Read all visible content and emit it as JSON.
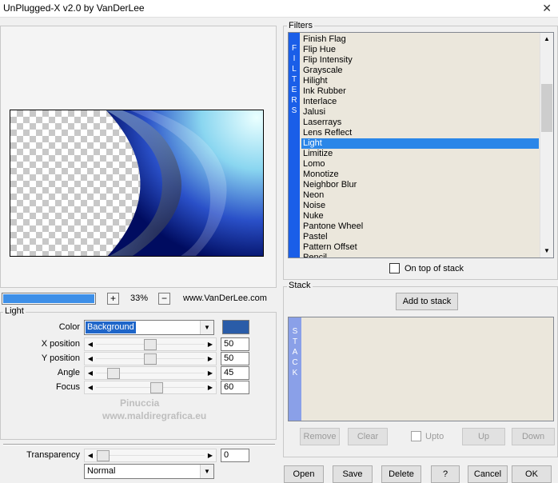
{
  "window": {
    "title": "UnPlugged-X v2.0 by VanDerLee",
    "close": "✕"
  },
  "zoom": {
    "progress": 1.0,
    "plus": "+",
    "minus": "−",
    "value": "33%",
    "site": "www.VanDerLee.com"
  },
  "light": {
    "group_title": "Light",
    "color_label": "Color",
    "color_value": "Background",
    "swatch_color": "#2a5ca8",
    "sliders": [
      {
        "label": "X position",
        "value": "50",
        "level": 50
      },
      {
        "label": "Y position",
        "value": "50",
        "level": 50
      },
      {
        "label": "Angle",
        "value": "45",
        "level": 12
      },
      {
        "label": "Focus",
        "value": "60",
        "level": 57
      }
    ],
    "transparency_label": "Transparency",
    "transparency_value": "0",
    "blend_mode": "Normal"
  },
  "filters": {
    "title": "Filters",
    "side_letters": [
      "F",
      "I",
      "L",
      "T",
      "E",
      "R",
      "S"
    ],
    "items": [
      "Finish Flag",
      "Flip Hue",
      "Flip Intensity",
      "Grayscale",
      "Hilight",
      "Ink Rubber",
      "Interlace",
      "Jalusi",
      "Laserrays",
      "Lens Reflect",
      "Light",
      "Limitize",
      "Lomo",
      "Monotize",
      "Neighbor Blur",
      "Neon",
      "Noise",
      "Nuke",
      "Pantone Wheel",
      "Pastel",
      "Pattern Offset",
      "Pencil"
    ],
    "selected_index": 10,
    "on_top_label": "On top of stack"
  },
  "stack": {
    "title": "Stack",
    "add_label": "Add to stack",
    "side_letters": [
      "S",
      "T",
      "A",
      "C",
      "K"
    ],
    "remove": "Remove",
    "clear": "Clear",
    "upto": "Upto",
    "up": "Up",
    "down": "Down"
  },
  "footer_buttons": [
    "Open",
    "Save",
    "Delete",
    "?",
    "Cancel",
    "OK"
  ],
  "watermark": {
    "line1": "Pinuccia",
    "line2": "www.maldiregrafica.eu"
  }
}
